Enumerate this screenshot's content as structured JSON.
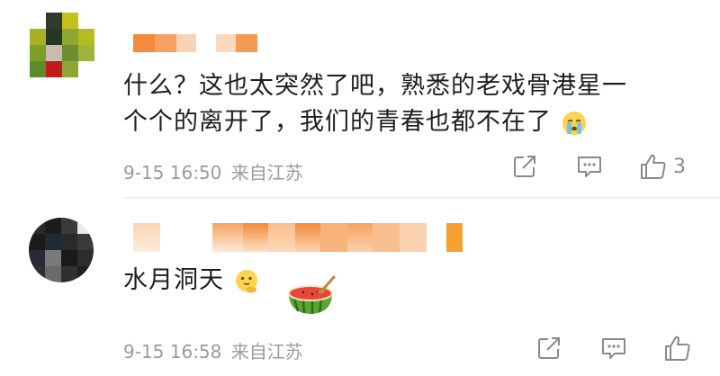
{
  "comments": [
    {
      "text_lines": [
        "什么？这也太突然了吧，熟悉的老戏骨港星一",
        "个个的离开了，我们的青春也都不在了"
      ],
      "emoji_icon": "crying-emoji-icon",
      "time": "9-15 16:50",
      "source": "来自江苏",
      "like_count": "3"
    },
    {
      "text": "水月洞天",
      "emoji_icons": [
        "thinking-emoji-icon",
        "watermelon-emoji-icon"
      ],
      "time": "9-15 16:58",
      "source": "来自江苏",
      "like_count": ""
    }
  ],
  "colors": {
    "text": "#1e1e1e",
    "meta": "#9b9b9b",
    "icon": "#8a8a8a",
    "username_blur": "#f58a3c"
  },
  "icons": [
    "share-icon",
    "comment-icon",
    "like-icon"
  ]
}
